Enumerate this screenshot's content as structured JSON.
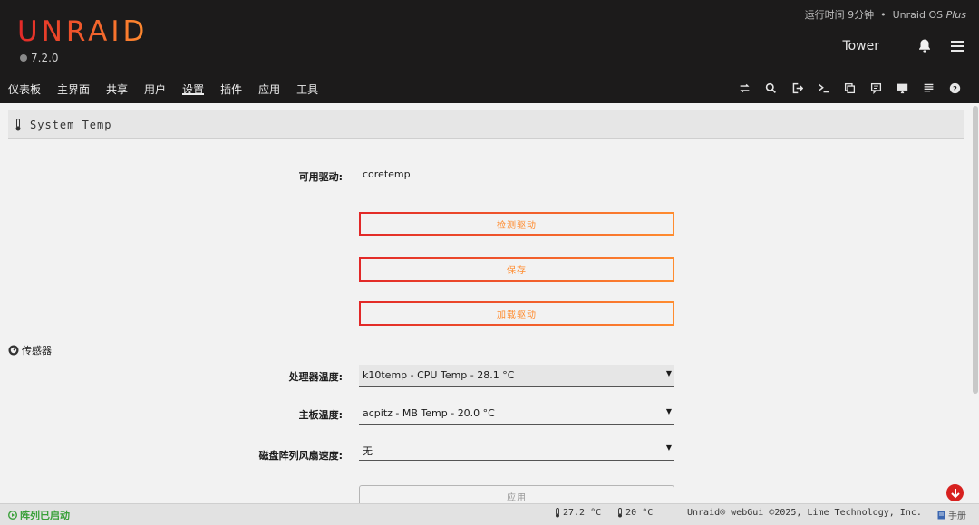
{
  "header": {
    "logo": "UNRAID",
    "version": "7.2.0",
    "uptime": "运行时间 9分钟",
    "os_label": "Unraid OS",
    "os_plus": "Plus",
    "server_name": "Tower"
  },
  "nav": {
    "items": [
      {
        "label": "仪表板"
      },
      {
        "label": "主界面"
      },
      {
        "label": "共享"
      },
      {
        "label": "用户"
      },
      {
        "label": "设置"
      },
      {
        "label": "插件"
      },
      {
        "label": "应用"
      },
      {
        "label": "工具"
      }
    ],
    "active": "设置",
    "toolbar_icons": [
      "switch-icon",
      "search-icon",
      "logout-icon",
      "terminal-icon",
      "copy-icon",
      "chat-icon",
      "monitor-icon",
      "log-icon",
      "help-icon"
    ]
  },
  "page": {
    "title": "System Temp"
  },
  "form": {
    "driver_label": "可用驱动:",
    "driver_value": "coretemp",
    "detect_button": "检测驱动",
    "save_button": "保存",
    "load_button": "加载驱动",
    "sensors_section": "传感器",
    "cpu_label": "处理器温度:",
    "cpu_value": "k10temp - CPU Temp - 28.1 °C",
    "mb_label": "主板温度:",
    "mb_value": "acpitz - MB Temp - 20.0 °C",
    "fan_label": "磁盘阵列风扇速度:",
    "fan_value": "无",
    "apply_button": "应用"
  },
  "footer": {
    "array_status": "阵列已启动",
    "cpu_temp": "27.2 °C",
    "mb_temp": "20 °C",
    "copyright": "Unraid® webGui ©2025, Lime Technology, Inc.",
    "manual": "手册"
  },
  "colors": {
    "accent_start": "#e22828",
    "accent_end": "#ff8c2f",
    "header_bg": "#1c1b1b",
    "status_green": "#3aa03a"
  }
}
